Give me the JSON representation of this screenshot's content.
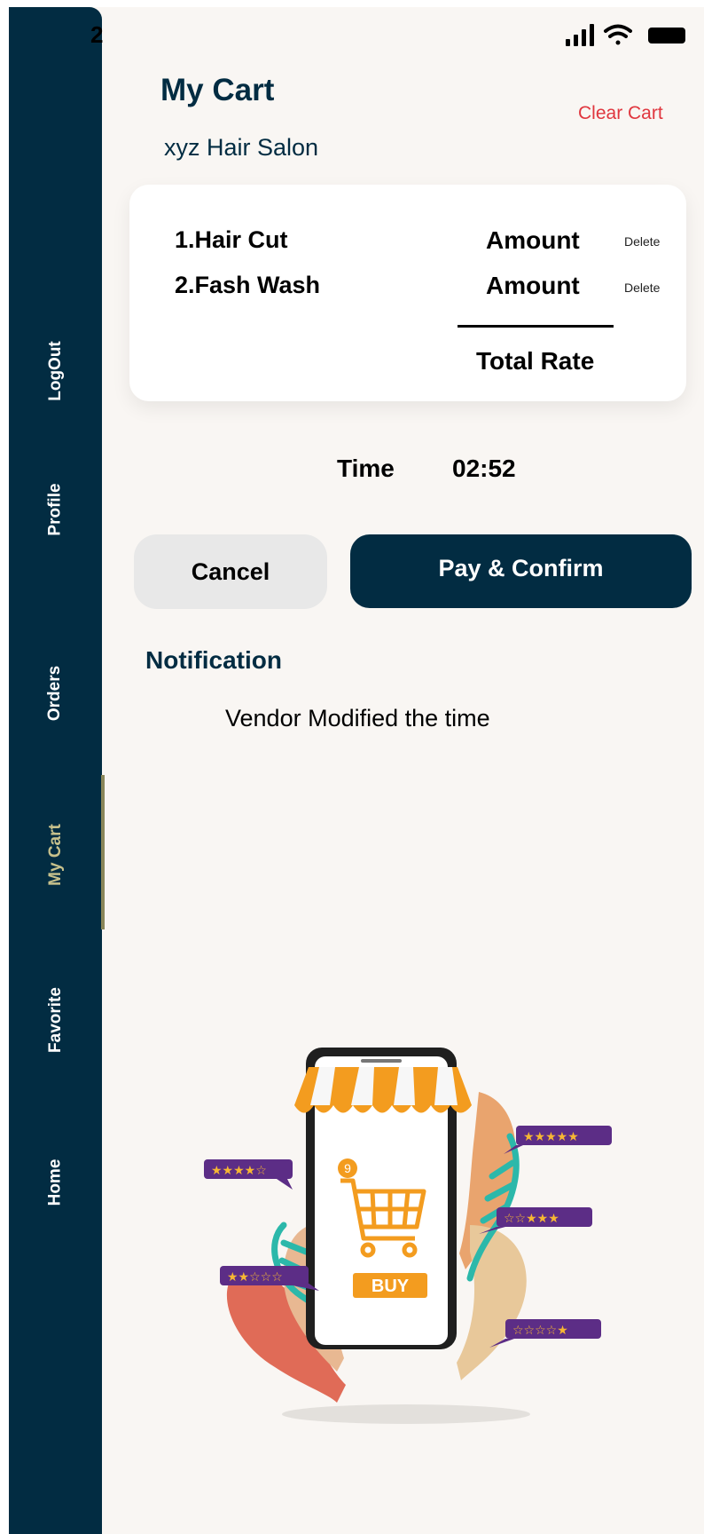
{
  "status_bar": {
    "time": "2",
    "icons": [
      "signal-icon",
      "wifi-icon",
      "battery-icon"
    ]
  },
  "sidebar": {
    "items": [
      {
        "label": "LogOut"
      },
      {
        "label": "Profile"
      },
      {
        "label": "Orders"
      },
      {
        "label": "My Cart",
        "active": true
      },
      {
        "label": "Favorite"
      },
      {
        "label": "Home"
      }
    ]
  },
  "header": {
    "title": "My Cart",
    "clear_label": "Clear Cart",
    "salon_name": "xyz Hair Salon"
  },
  "cart": {
    "items": [
      {
        "name": "1.Hair Cut",
        "amount": "Amount",
        "delete_label": "Delete"
      },
      {
        "name": "2.Fash Wash",
        "amount": "Amount",
        "delete_label": "Delete"
      }
    ],
    "total_label": "Total Rate"
  },
  "time": {
    "label": "Time",
    "value": "02:52"
  },
  "actions": {
    "cancel_label": "Cancel",
    "confirm_label": "Pay & Confirm"
  },
  "notification": {
    "title": "Notification",
    "message": "Vendor Modified the time"
  },
  "illustration": {
    "badge_count": "9",
    "buy_label": "BUY"
  },
  "colors": {
    "sidebar": "#022c42",
    "active_nav": "#c7c18c",
    "clear_cart": "#e0363e",
    "background": "#f9f6f3",
    "awning": "#f39c1f",
    "rating_badge": "#5c2d86"
  }
}
